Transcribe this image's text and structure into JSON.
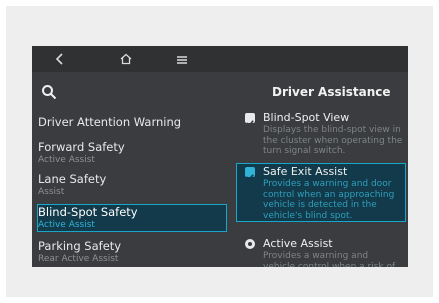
{
  "header": {
    "title": "Driver Assistance",
    "back_icon": "chevron-left-icon",
    "home_icon": "home-icon",
    "menu_icon": "menu-icon",
    "search_icon": "search-icon"
  },
  "left_menu": [
    {
      "label": "Driver Attention Warning",
      "sub": ""
    },
    {
      "label": "Forward Safety",
      "sub": "Active Assist"
    },
    {
      "label": "Lane Safety",
      "sub": "Assist"
    },
    {
      "label": "Blind-Spot Safety",
      "sub": "Active Assist",
      "selected": true
    },
    {
      "label": "Parking Safety",
      "sub": "Rear Active Assist"
    }
  ],
  "options": [
    {
      "type": "checkbox",
      "label": "Blind-Spot View",
      "desc": "Displays the blind-spot view in the cluster when operating the turn signal switch."
    },
    {
      "type": "checkbox",
      "label": "Safe Exit Assist",
      "desc": "Provides a warning and door control when an approaching vehicle is detected in the vehicle's blind spot.",
      "selected": true
    },
    {
      "type": "radio",
      "label": "Active Assist",
      "desc": "Provides a warning and vehicle control when a risk of blind..."
    }
  ],
  "colors": {
    "accent": "#1aa6c8",
    "selected_bg": "#123a4a",
    "screen_bg": "#3a3c3f"
  }
}
